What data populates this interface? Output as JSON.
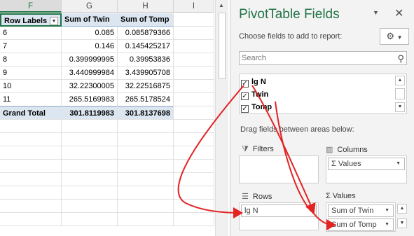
{
  "sheet": {
    "columns": [
      "F",
      "G",
      "H",
      "I"
    ],
    "selected_column": "F",
    "header": {
      "row_labels": "Row Labels",
      "twin": "Sum of Twin",
      "tomp": "Sum of Tomp"
    },
    "rows": [
      {
        "label": "6",
        "twin": "0.085",
        "tomp": "0.085879366"
      },
      {
        "label": "7",
        "twin": "0.146",
        "tomp": "0.145425217"
      },
      {
        "label": "8",
        "twin": "0.399999995",
        "tomp": "0.39953836"
      },
      {
        "label": "9",
        "twin": "3.440999984",
        "tomp": "3.439905708"
      },
      {
        "label": "10",
        "twin": "32.22300005",
        "tomp": "32.22516875"
      },
      {
        "label": "11",
        "twin": "265.5169983",
        "tomp": "265.5178524"
      }
    ],
    "total": {
      "label": "Grand Total",
      "twin": "301.8119983",
      "tomp": "301.8137698"
    }
  },
  "pane": {
    "title": "PivotTable Fields",
    "choose_label": "Choose fields to add to report:",
    "search_placeholder": "Search",
    "fields": [
      {
        "name": "lg N",
        "checked": true
      },
      {
        "name": "Twin",
        "checked": true
      },
      {
        "name": "Tomp",
        "checked": true
      }
    ],
    "drag_label": "Drag fields between areas below:",
    "areas": {
      "filters": {
        "title": "Filters",
        "icon": "filter-icon"
      },
      "columns": {
        "title": "Columns",
        "icon": "columns-icon",
        "chip": "Σ Values"
      },
      "rows": {
        "title": "Rows",
        "icon": "rows-icon",
        "chip": "lg N"
      },
      "values": {
        "title": "Σ Values",
        "icon": "sigma-icon",
        "chips": [
          "Sum of Twin",
          "Sum of Tomp"
        ]
      }
    }
  },
  "colors": {
    "accent": "#217346",
    "annotation": "#e32222",
    "pivot_header": "#dce6f1"
  }
}
